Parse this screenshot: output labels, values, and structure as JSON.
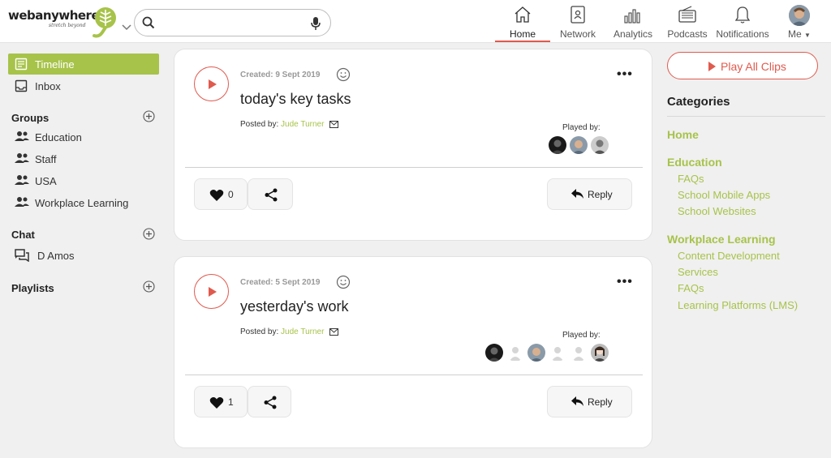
{
  "brand": {
    "name": "webanywhere",
    "tagline": "stretch beyond",
    "accent": "#a7c34a",
    "alert": "#e05a4e"
  },
  "search": {
    "placeholder": "",
    "value": ""
  },
  "nav": [
    {
      "label": "Home",
      "icon": "home-icon",
      "active": true
    },
    {
      "label": "Network",
      "icon": "address-book-icon"
    },
    {
      "label": "Analytics",
      "icon": "bar-chart-icon"
    },
    {
      "label": "Podcasts",
      "icon": "radio-icon"
    },
    {
      "label": "Notifications",
      "icon": "bell-icon"
    },
    {
      "label": "Me",
      "icon": "avatar"
    }
  ],
  "sidebar": {
    "timeline": "Timeline",
    "inbox": "Inbox",
    "groups_heading": "Groups",
    "groups": [
      "Education",
      "Staff",
      "USA",
      "Workplace Learning"
    ],
    "chat_heading": "Chat",
    "chats": [
      "D Amos"
    ],
    "playlists_heading": "Playlists"
  },
  "posts": [
    {
      "created": "Created: 9 Sept 2019",
      "title": "today's key tasks",
      "posted_by_label": "Posted by:",
      "author": "Jude Turner",
      "played_by_label": "Played by:",
      "likes": "0",
      "reply_label": "Reply"
    },
    {
      "created": "Created: 5 Sept 2019",
      "title": "yesterday's work",
      "posted_by_label": "Posted by:",
      "author": "Jude Turner",
      "played_by_label": "Played by:",
      "likes": "1",
      "reply_label": "Reply"
    }
  ],
  "right": {
    "play_all": "Play All Clips",
    "categories_title": "Categories",
    "home": "Home",
    "education": "Education",
    "education_items": [
      "FAQs",
      "School Mobile Apps",
      "School Websites"
    ],
    "workplace": "Workplace Learning",
    "workplace_items": [
      "Content Development",
      "Services",
      "FAQs",
      "Learning Platforms (LMS)"
    ]
  }
}
